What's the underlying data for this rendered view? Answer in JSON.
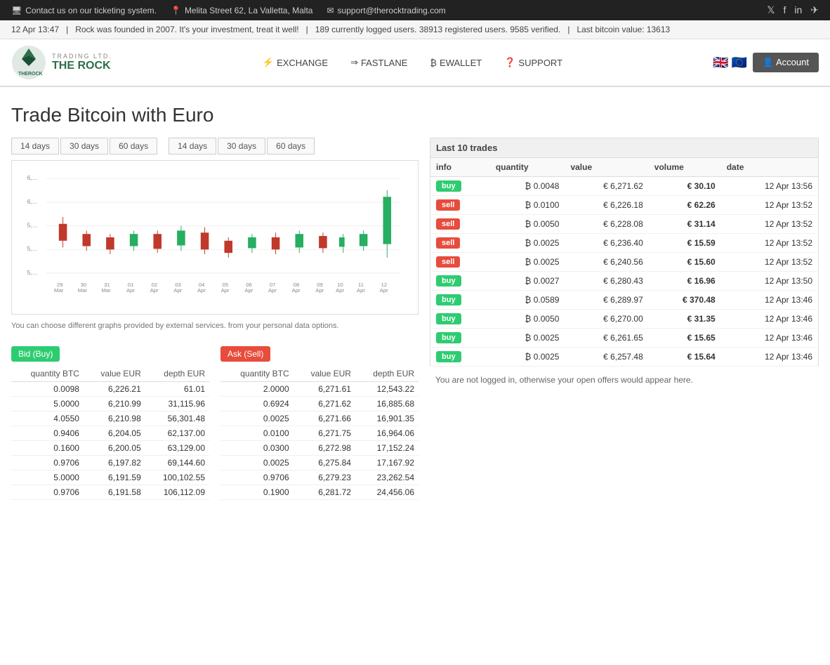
{
  "topBar": {
    "contact": "Contact us on our ticketing system.",
    "address": "Melita Street 62, La Valletta, Malta",
    "email": "support@therocktrading.com",
    "icons": [
      "twitter",
      "facebook",
      "linkedin",
      "telegram"
    ]
  },
  "ticker": {
    "date": "12 Apr 13:47",
    "message": "Rock was founded in 2007. It's your investment, treat it well!",
    "users": "189 currently logged users. 38913 registered users. 9585 verified.",
    "bitcoin": "Last bitcoin value: 13613"
  },
  "header": {
    "logoAlt": "The Rock Trading",
    "nav": [
      {
        "label": "EXCHANGE",
        "icon": "⚡"
      },
      {
        "label": "FASTLANE",
        "icon": "→"
      },
      {
        "label": "EWALLET",
        "icon": "₿"
      },
      {
        "label": "SUPPORT",
        "icon": "?"
      }
    ],
    "account": "Account"
  },
  "page": {
    "title": "Trade Bitcoin with Euro"
  },
  "chartTabs": {
    "group1": [
      "14 days",
      "30 days",
      "60 days"
    ],
    "group2": [
      "14 days",
      "30 days",
      "60 days"
    ]
  },
  "chartNote": "You can choose different graphs provided by external services. from your personal data options.",
  "orderBook": {
    "bidLabel": "Bid (Buy)",
    "askLabel": "Ask (Sell)",
    "bidHeaders": [
      "quantity BTC",
      "value EUR",
      "depth EUR"
    ],
    "askHeaders": [
      "quantity BTC",
      "value EUR",
      "depth EUR"
    ],
    "bids": [
      {
        "qty": "0.0098",
        "value": "6,226.21",
        "depth": "61.01"
      },
      {
        "qty": "5.0000",
        "value": "6,210.99",
        "depth": "31,115.96"
      },
      {
        "qty": "4.0550",
        "value": "6,210.98",
        "depth": "56,301.48"
      },
      {
        "qty": "0.9406",
        "value": "6,204.05",
        "depth": "62,137.00"
      },
      {
        "qty": "0.1600",
        "value": "6,200.05",
        "depth": "63,129.00"
      },
      {
        "qty": "0.9706",
        "value": "6,197.82",
        "depth": "69,144.60"
      },
      {
        "qty": "5.0000",
        "value": "6,191.59",
        "depth": "100,102.55"
      },
      {
        "qty": "0.9706",
        "value": "6,191.58",
        "depth": "106,112.09"
      }
    ],
    "asks": [
      {
        "qty": "2.0000",
        "value": "6,271.61",
        "depth": "12,543.22"
      },
      {
        "qty": "0.6924",
        "value": "6,271.62",
        "depth": "16,885.68"
      },
      {
        "qty": "0.0025",
        "value": "6,271.66",
        "depth": "16,901.35"
      },
      {
        "qty": "0.0100",
        "value": "6,271.75",
        "depth": "16,964.06"
      },
      {
        "qty": "0.0300",
        "value": "6,272.98",
        "depth": "17,152.24"
      },
      {
        "qty": "0.0025",
        "value": "6,275.84",
        "depth": "17,167.92"
      },
      {
        "qty": "0.9706",
        "value": "6,279.23",
        "depth": "23,262.54"
      },
      {
        "qty": "0.1900",
        "value": "6,281.72",
        "depth": "24,456.06"
      }
    ]
  },
  "trades": {
    "caption": "Last 10 trades",
    "headers": [
      "info",
      "quantity",
      "value",
      "volume",
      "date"
    ],
    "rows": [
      {
        "type": "buy",
        "qty": "₿ 0.0048",
        "value": "€ 6,271.62",
        "volume": "€ 30.10",
        "date": "12 Apr 13:56"
      },
      {
        "type": "sell",
        "qty": "₿ 0.0100",
        "value": "€ 6,226.18",
        "volume": "€ 62.26",
        "date": "12 Apr 13:52"
      },
      {
        "type": "sell",
        "qty": "₿ 0.0050",
        "value": "€ 6,228.08",
        "volume": "€ 31.14",
        "date": "12 Apr 13:52"
      },
      {
        "type": "sell",
        "qty": "₿ 0.0025",
        "value": "€ 6,236.40",
        "volume": "€ 15.59",
        "date": "12 Apr 13:52"
      },
      {
        "type": "sell",
        "qty": "₿ 0.0025",
        "value": "€ 6,240.56",
        "volume": "€ 15.60",
        "date": "12 Apr 13:52"
      },
      {
        "type": "buy",
        "qty": "₿ 0.0027",
        "value": "€ 6,280.43",
        "volume": "€ 16.96",
        "date": "12 Apr 13:50"
      },
      {
        "type": "buy",
        "qty": "₿ 0.0589",
        "value": "€ 6,289.97",
        "volume": "€ 370.48",
        "date": "12 Apr 13:46"
      },
      {
        "type": "buy",
        "qty": "₿ 0.0050",
        "value": "€ 6,270.00",
        "volume": "€ 31.35",
        "date": "12 Apr 13:46"
      },
      {
        "type": "buy",
        "qty": "₿ 0.0025",
        "value": "€ 6,261.65",
        "volume": "€ 15.65",
        "date": "12 Apr 13:46"
      },
      {
        "type": "buy",
        "qty": "₿ 0.0025",
        "value": "€ 6,257.48",
        "volume": "€ 15.64",
        "date": "12 Apr 13:46"
      }
    ],
    "notLoggedMessage": "You are not logged in, otherwise your open offers would appear here."
  }
}
